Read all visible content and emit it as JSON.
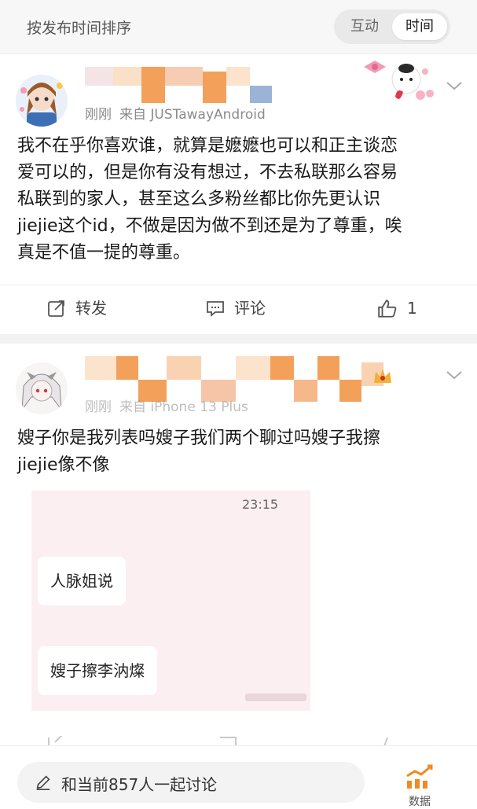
{
  "header": {
    "sort_label": "按发布时间排序",
    "tabs": [
      {
        "label": "互动",
        "active": false
      },
      {
        "label": "时间",
        "active": true
      }
    ]
  },
  "posts": [
    {
      "meta_time": "刚刚",
      "meta_source": "来自 JUSTawayAndroid",
      "text_lines": [
        "我不在乎你喜欢谁，就算是嬷嬷也可以和正主谈恋",
        "爱可以的，但是你有没有想过，不去私联那么容易",
        "私联到的家人，甚至这么多粉丝都比你先更认识",
        "jiejie这个id，不做是因为做不到还是为了尊重，唉",
        "真是不值一提的尊重。"
      ],
      "actions": {
        "repost": "转发",
        "comment": "评论",
        "like_count": "1"
      }
    },
    {
      "meta_time": "刚刚",
      "meta_source": "来自 iPhone 13 Plus",
      "text_lines": [
        "嫂子你是我列表吗嫂子我们两个聊过吗嫂子我擦",
        "jiejie像不像"
      ],
      "screenshot": {
        "time": "23:15",
        "bubbles": [
          "人脉姐说",
          "嫂子擦李汭燦"
        ]
      }
    }
  ],
  "bottom": {
    "discuss_label": "和当前857人一起讨论",
    "data_label": "数据"
  },
  "colors": {
    "mosaic_orange": "#f3a05a",
    "mosaic_peach": "#f9d2b2",
    "accent_orange": "#f08a24"
  }
}
